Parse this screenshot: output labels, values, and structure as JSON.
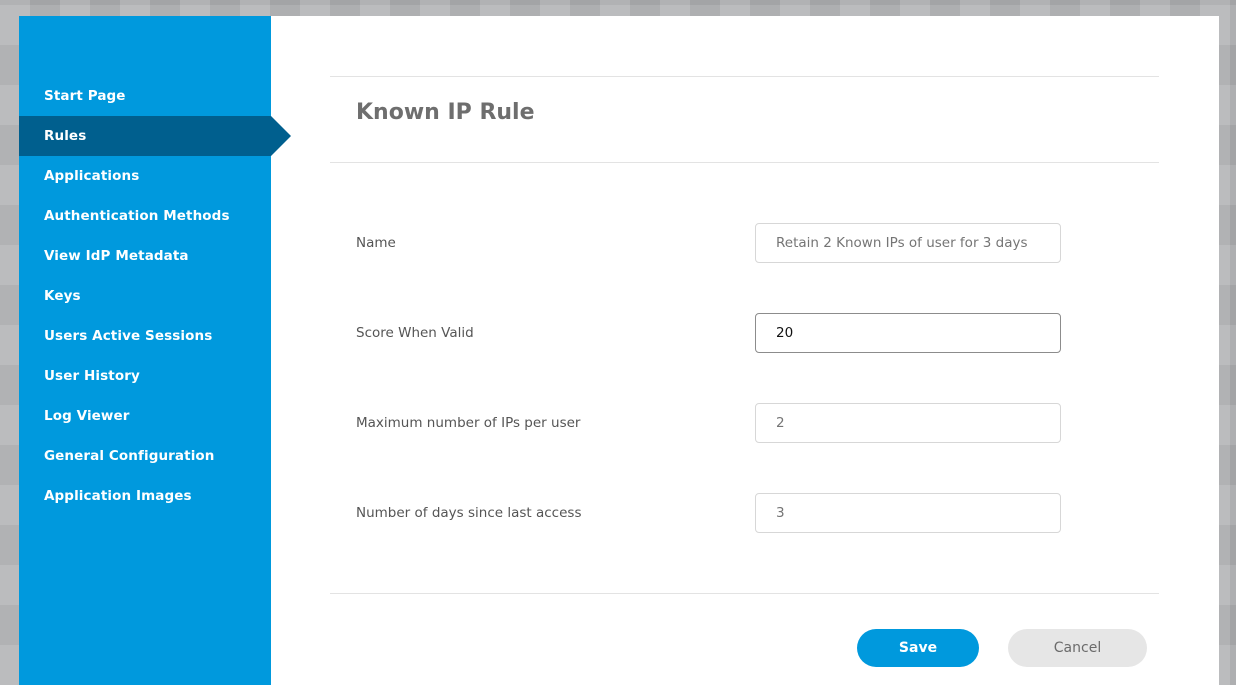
{
  "sidebar": {
    "items": [
      {
        "label": "Start Page"
      },
      {
        "label": "Rules",
        "active": true
      },
      {
        "label": "Applications"
      },
      {
        "label": "Authentication Methods"
      },
      {
        "label": "View IdP Metadata"
      },
      {
        "label": "Keys"
      },
      {
        "label": "Users Active Sessions"
      },
      {
        "label": "User History"
      },
      {
        "label": "Log Viewer"
      },
      {
        "label": "General Configuration"
      },
      {
        "label": "Application Images"
      }
    ]
  },
  "page": {
    "title": "Known IP Rule"
  },
  "form": {
    "name": {
      "label": "Name",
      "value": "",
      "placeholder": "Retain 2 Known IPs of user for 3 days"
    },
    "score": {
      "label": "Score When Valid",
      "value": "20",
      "placeholder": ""
    },
    "max_ips": {
      "label": "Maximum number of IPs per user",
      "value": "",
      "placeholder": "2"
    },
    "days": {
      "label": "Number of days since last access",
      "value": "",
      "placeholder": "3"
    }
  },
  "actions": {
    "save_label": "Save",
    "cancel_label": "Cancel"
  },
  "colors": {
    "sidebar_bg": "#0099dd",
    "sidebar_active": "#005f8e",
    "primary": "#0099dd"
  }
}
